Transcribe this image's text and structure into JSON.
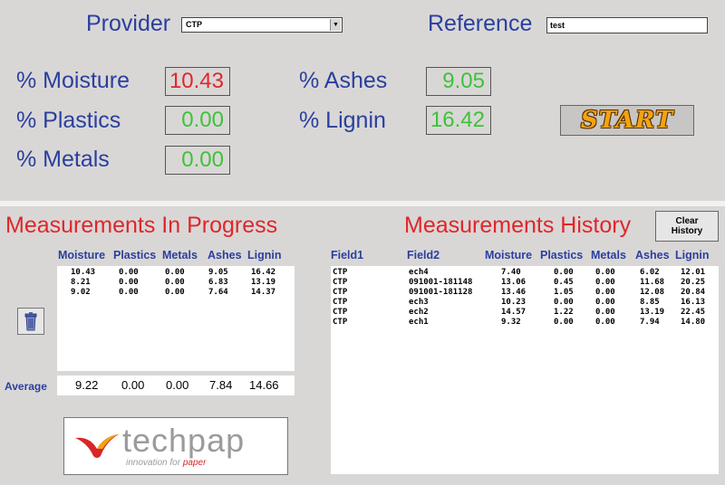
{
  "header": {
    "provider_label": "Provider",
    "provider_value": "CTP",
    "reference_label": "Reference",
    "reference_value": "test"
  },
  "measures": {
    "moisture": {
      "label": "% Moisture",
      "value": "10.43"
    },
    "plastics": {
      "label": "% Plastics",
      "value": "0.00"
    },
    "metals": {
      "label": "% Metals",
      "value": "0.00"
    },
    "ashes": {
      "label": "% Ashes",
      "value": "9.05"
    },
    "lignin": {
      "label": "% Lignin",
      "value": "16.42"
    }
  },
  "start_label": "START",
  "colors": {
    "label_blue": "#2a3f9e",
    "title_red": "#e0262a",
    "value_green": "#3ec23a",
    "value_red": "#e0262a"
  },
  "progress": {
    "title": "Measurements In Progress",
    "headers": [
      "Moisture",
      "Plastics",
      "Metals",
      "Ashes",
      "Lignin"
    ],
    "rows": [
      [
        "10.43",
        "0.00",
        "0.00",
        "9.05",
        "16.42"
      ],
      [
        "8.21",
        "0.00",
        "0.00",
        "6.83",
        "13.19"
      ],
      [
        "9.02",
        "0.00",
        "0.00",
        "7.64",
        "14.37"
      ]
    ],
    "average_label": "Average",
    "average": [
      "9.22",
      "0.00",
      "0.00",
      "7.84",
      "14.66"
    ],
    "trash_icon": "trash-icon"
  },
  "history": {
    "title": "Measurements History",
    "clear_label_1": "Clear",
    "clear_label_2": "History",
    "headers": [
      "Field1",
      "Field2",
      "Moisture",
      "Plastics",
      "Metals",
      "Ashes",
      "Lignin"
    ],
    "rows": [
      [
        "CTP",
        "ech4",
        "7.40",
        "0.00",
        "0.00",
        "6.02",
        "12.01"
      ],
      [
        "CTP",
        "091001-181148",
        "13.06",
        "0.45",
        "0.00",
        "11.68",
        "20.25"
      ],
      [
        "CTP",
        "091001-181128",
        "13.46",
        "1.05",
        "0.00",
        "12.08",
        "20.84"
      ],
      [
        "CTP",
        "ech3",
        "10.23",
        "0.00",
        "0.00",
        "8.85",
        "16.13"
      ],
      [
        "CTP",
        "ech2",
        "14.57",
        "1.22",
        "0.00",
        "13.19",
        "22.45"
      ],
      [
        "CTP",
        "ech1",
        "9.32",
        "0.00",
        "0.00",
        "7.94",
        "14.80"
      ]
    ]
  },
  "logo": {
    "name": "techpap",
    "tagline_prefix": "innovation for ",
    "tagline_accent": "paper"
  }
}
